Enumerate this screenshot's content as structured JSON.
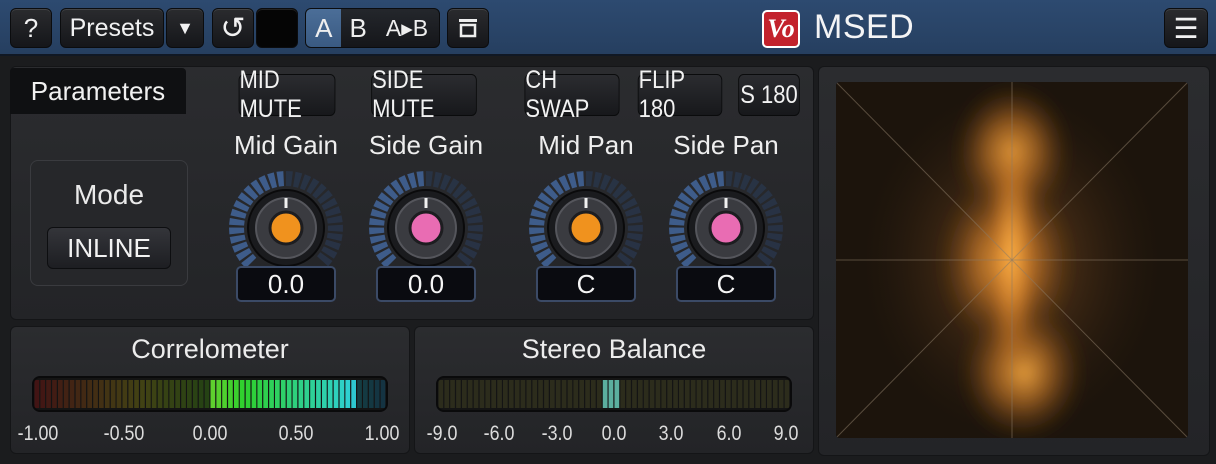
{
  "toolbar": {
    "help_label": "?",
    "presets_label": "Presets",
    "dropdown_glyph": "▼",
    "undo_glyph": "↺",
    "ab": {
      "a_label": "A",
      "b_label": "B",
      "copy_label": "A▸B",
      "active": "A"
    },
    "brand_name": "MSED",
    "logo_text": "Vo",
    "menu_glyph": "☰"
  },
  "parameters": {
    "tab_label": "Parameters",
    "toggles": {
      "mid_mute": "MID MUTE",
      "side_mute": "SIDE MUTE",
      "ch_swap": "CH SWAP",
      "flip180": "FLIP 180",
      "s180": "S 180"
    },
    "mode": {
      "label": "Mode",
      "value": "INLINE"
    },
    "knobs": [
      {
        "title": "Mid Gain",
        "value": "0.0",
        "color": "#f0921e"
      },
      {
        "title": "Side Gain",
        "value": "0.0",
        "color": "#e96cb3"
      },
      {
        "title": "Mid Pan",
        "value": "C",
        "color": "#f0921e"
      },
      {
        "title": "Side Pan",
        "value": "C",
        "color": "#e96cb3"
      }
    ]
  },
  "correlometer": {
    "title": "Correlometer",
    "ticks": [
      "-1.00",
      "-0.50",
      "0.00",
      "0.50",
      "1.00"
    ]
  },
  "stereo_balance": {
    "title": "Stereo Balance",
    "ticks": [
      "-9.0",
      "-6.0",
      "-3.0",
      "0.0",
      "3.0",
      "6.0",
      "9.0"
    ]
  },
  "colors": {
    "topbar": "#2b4668",
    "accent": "#3a5a82",
    "orange": "#f0921e",
    "pink": "#e96cb3"
  }
}
